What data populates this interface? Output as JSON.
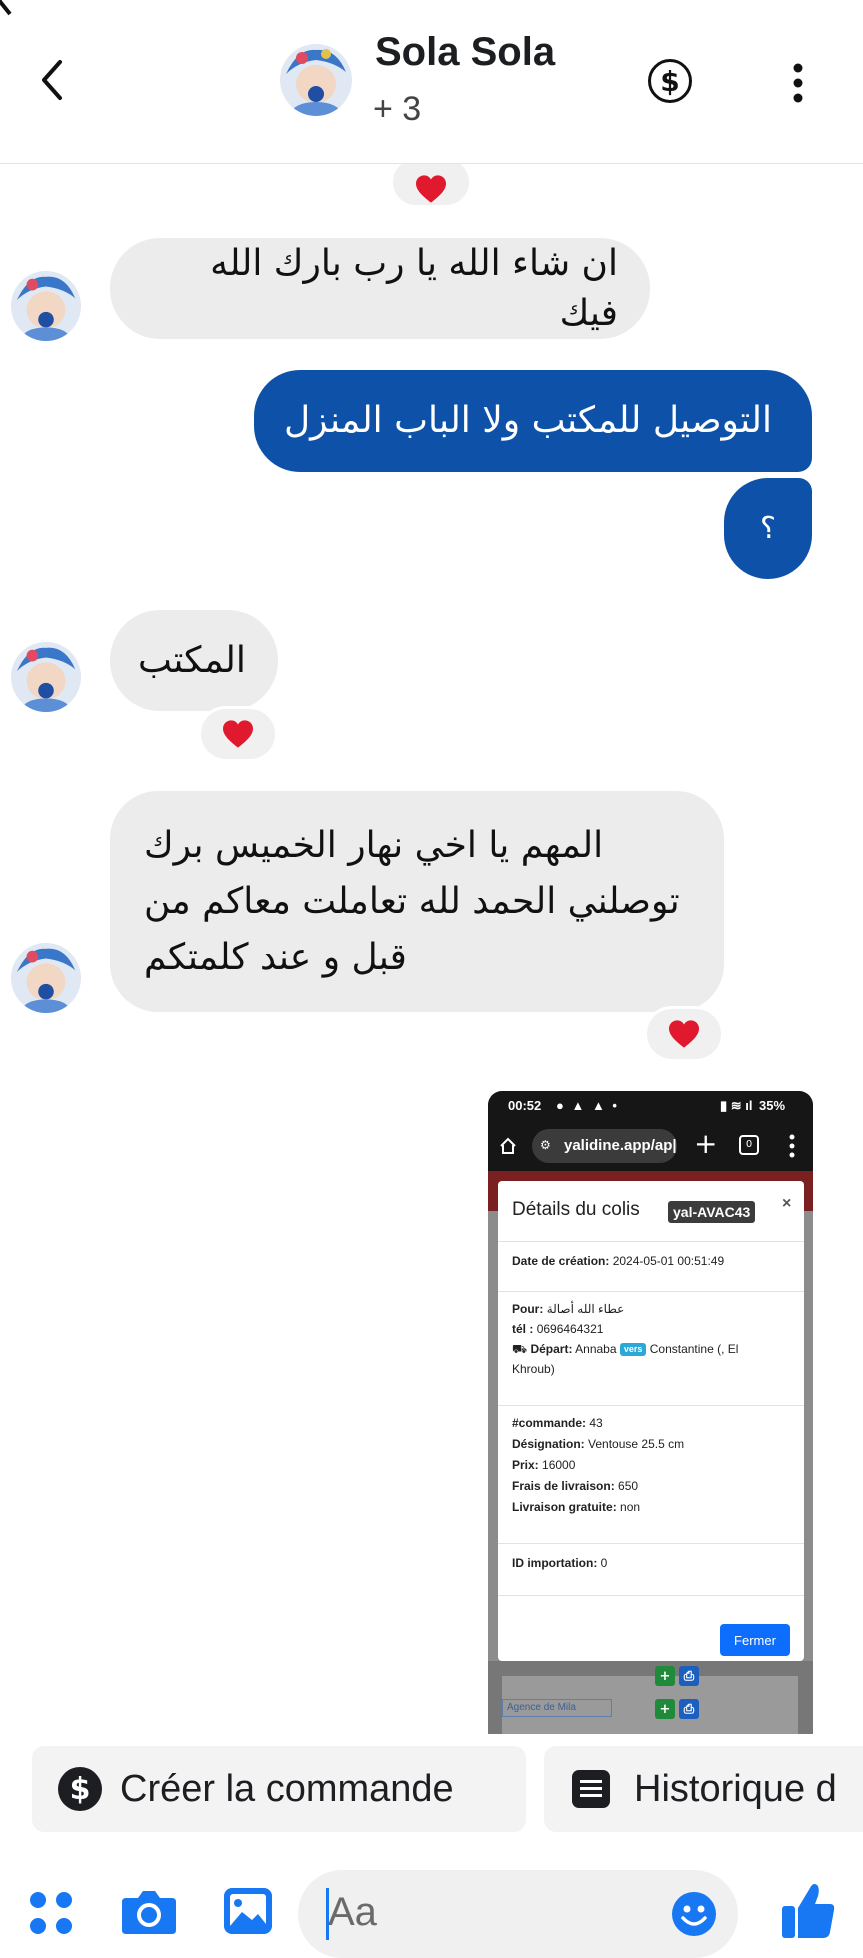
{
  "header": {
    "contact_name": "Sola Sola",
    "subtitle": "+ 3"
  },
  "messages": [
    {
      "id": "m1",
      "direction": "incoming",
      "text": "ان شاء الله يا رب بارك الله فيك"
    },
    {
      "id": "m2",
      "direction": "outgoing",
      "text": "التوصيل للمكتب ولا الباب المنزل"
    },
    {
      "id": "m3",
      "direction": "outgoing",
      "text": "؟"
    },
    {
      "id": "m4",
      "direction": "incoming",
      "text": "المكتب",
      "reaction": "heart"
    },
    {
      "id": "m5",
      "direction": "incoming",
      "lines": [
        "المهم يا اخي نهار الخميس برك",
        "توصلني الحمد لله تعاملت معاكم من",
        "قبل و عند كلمتكم"
      ],
      "reaction": "heart"
    }
  ],
  "attachment": {
    "status_time": "00:52",
    "status_battery": "35%",
    "url": "yalidine.app/ap|",
    "modal": {
      "title": "Détails du colis",
      "tracking": "yal-AVAC43",
      "close": "×",
      "date_label": "Date de création:",
      "date_value": "2024-05-01 00:51:49",
      "pour_label": "Pour:",
      "pour_value": "عطاء الله أصالة",
      "tel_label": "tél :",
      "tel_value": "0696464321",
      "depart_label": "Départ:",
      "depart_from": "Annaba",
      "vers": "vers",
      "depart_to": "Constantine (, El",
      "depart_to_2": "Khroub)",
      "commande_label": "#commande:",
      "commande_value": "43",
      "designation_label": "Désignation:",
      "designation_value": "Ventouse 25.5 cm",
      "prix_label": "Prix:",
      "prix_value": "16000",
      "frais_label": "Frais de livraison:",
      "frais_value": "650",
      "gratuite_label": "Livraison gratuite:",
      "gratuite_value": "non",
      "import_label": "ID importation:",
      "import_value": "0",
      "fermer": "Fermer"
    },
    "table_agency": "Agence de Mila"
  },
  "quick_actions": [
    {
      "label": "Créer la commande",
      "icon": "dollar-circle-icon"
    },
    {
      "label": "Historique d",
      "icon": "list-icon"
    }
  ],
  "composer": {
    "placeholder": "Aa"
  },
  "colors": {
    "outgoing_bubble": "#0d52a8",
    "incoming_bubble": "#ececec",
    "accent": "#1877f2"
  }
}
